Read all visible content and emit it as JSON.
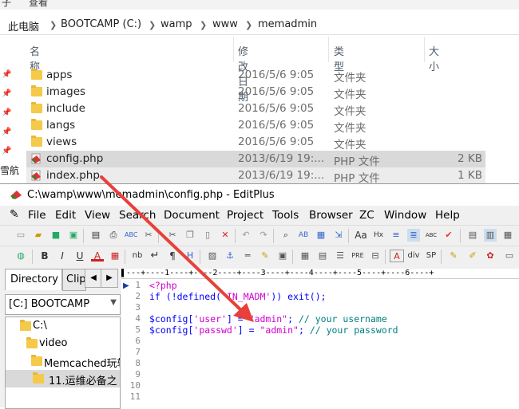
{
  "explorer": {
    "menu": [
      "子",
      "查看"
    ],
    "breadcrumb": [
      "此电脑",
      "BOOTCAMP (C:)",
      "wamp",
      "www",
      "memadmin"
    ],
    "columns": {
      "name": "名称",
      "date": "修改日期",
      "type": "类型",
      "size": "大小"
    },
    "rows": [
      {
        "name": "apps",
        "date": "2016/5/6 9:05",
        "type": "文件夹",
        "size": "",
        "icon": "folder-icon"
      },
      {
        "name": "images",
        "date": "2016/5/6 9:05",
        "type": "文件夹",
        "size": "",
        "icon": "folder-icon"
      },
      {
        "name": "include",
        "date": "2016/5/6 9:05",
        "type": "文件夹",
        "size": "",
        "icon": "folder-icon"
      },
      {
        "name": "langs",
        "date": "2016/5/6 9:05",
        "type": "文件夹",
        "size": "",
        "icon": "folder-icon"
      },
      {
        "name": "views",
        "date": "2016/5/6 9:05",
        "type": "文件夹",
        "size": "",
        "icon": "folder-icon"
      },
      {
        "name": "config.php",
        "date": "2013/6/19 19:...",
        "type": "PHP 文件",
        "size": "2 KB",
        "icon": "php-file-icon"
      },
      {
        "name": "index.php",
        "date": "2013/6/19 19:...",
        "type": "PHP 文件",
        "size": "1 KB",
        "icon": "php-file-icon"
      }
    ],
    "left_cut_label": "雪航"
  },
  "editplus": {
    "title": "C:\\wamp\\www\\memadmin\\config.php - EditPlus",
    "menu": [
      "File",
      "Edit",
      "View",
      "Search",
      "Document",
      "Project",
      "Tools",
      "Browser",
      "ZC",
      "Window",
      "Help"
    ],
    "dir_tab": "Directory",
    "clip_tab": "Clip",
    "drive": "[C:] BOOTCAMP",
    "tree": [
      "C:\\",
      "video",
      "Memcached玩转",
      "11.运维必备之"
    ],
    "ruler": "▌---+----1----+----2----+----3----+----4----+----5----+----6----+",
    "line_numbers": [
      "1",
      "2",
      "3",
      "4",
      "5",
      "6",
      "7",
      "8",
      "9",
      "10",
      "11"
    ],
    "code": [
      [
        {
          "t": "<?php",
          "c": "#d000d0"
        }
      ],
      [
        {
          "t": "if (!defined(",
          "c": "#0000ff"
        },
        {
          "t": "'IN_MADM'",
          "c": "#d000d0"
        },
        {
          "t": ")) exit();",
          "c": "#0000ff"
        }
      ],
      [],
      [
        {
          "t": "$config[",
          "c": "#0000ff"
        },
        {
          "t": "'user'",
          "c": "#d000d0"
        },
        {
          "t": "] = ",
          "c": "#0000ff"
        },
        {
          "t": "\"admin\"",
          "c": "#d000d0"
        },
        {
          "t": "; ",
          "c": "#0000ff"
        },
        {
          "t": "// your username",
          "c": "#008080"
        }
      ],
      [
        {
          "t": "$config[",
          "c": "#0000ff"
        },
        {
          "t": "'passwd'",
          "c": "#d000d0"
        },
        {
          "t": "] = ",
          "c": "#0000ff"
        },
        {
          "t": "\"admin\"",
          "c": "#d000d0"
        },
        {
          "t": "; ",
          "c": "#0000ff"
        },
        {
          "t": "// your password",
          "c": "#008080"
        }
      ]
    ]
  },
  "annotation": {
    "arrow_color": "#e8403a"
  }
}
